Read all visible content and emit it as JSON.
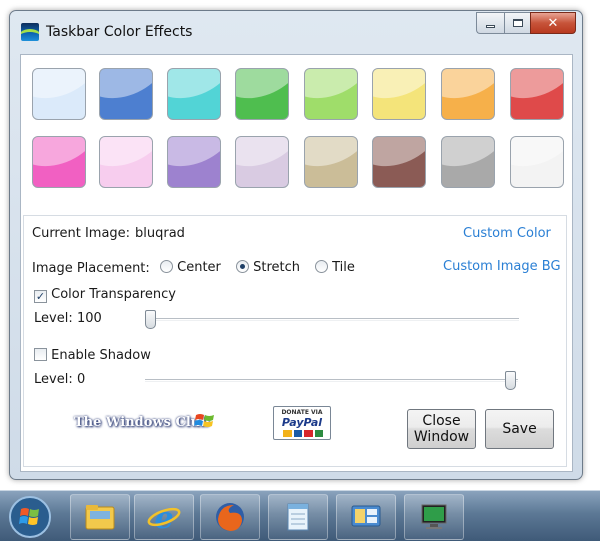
{
  "window": {
    "title": "Taskbar Color Effects",
    "close_glyph": "✕"
  },
  "swatches": [
    {
      "name": "swatch-white-blue",
      "color": "#dbeafa"
    },
    {
      "name": "swatch-blue",
      "color": "#4d7fd0"
    },
    {
      "name": "swatch-cyan",
      "color": "#52d4d6"
    },
    {
      "name": "swatch-green",
      "color": "#4fbe4f"
    },
    {
      "name": "swatch-lime",
      "color": "#9fdd6a"
    },
    {
      "name": "swatch-yellow",
      "color": "#f4e47a"
    },
    {
      "name": "swatch-orange",
      "color": "#f6b04a"
    },
    {
      "name": "swatch-red",
      "color": "#df4a4a"
    },
    {
      "name": "swatch-pink",
      "color": "#f160c2"
    },
    {
      "name": "swatch-light-pink",
      "color": "#f7cdee"
    },
    {
      "name": "swatch-purple",
      "color": "#9d82cf"
    },
    {
      "name": "swatch-lavender",
      "color": "#d9cbe2"
    },
    {
      "name": "swatch-tan",
      "color": "#cbbd98"
    },
    {
      "name": "swatch-brown",
      "color": "#8b5b55"
    },
    {
      "name": "swatch-gray",
      "color": "#a9a9a9"
    },
    {
      "name": "swatch-white",
      "color": "#f3f3f3"
    }
  ],
  "settings": {
    "current_image_label": "Current Image:",
    "current_image_value": "bluqrad",
    "custom_color_link": "Custom Color",
    "placement_label": "Image Placement:",
    "placement_options": [
      "Center",
      "Stretch",
      "Tile"
    ],
    "placement_selected": "Stretch",
    "custom_image_link": "Custom Image BG",
    "transparency_label": "Color Transparency",
    "transparency_checked": true,
    "transparency_level_label": "Level:",
    "transparency_level_value": "100",
    "shadow_label": "Enable Shadow",
    "shadow_checked": false,
    "shadow_level_label": "Level:",
    "shadow_level_value": "0"
  },
  "branding": {
    "twc_logo_text": "The Windows Club",
    "paypal_top": "DONATE VIA",
    "paypal_brand": "PayPal"
  },
  "buttons": {
    "close_window_line1": "Close",
    "close_window_line2": "Window",
    "save": "Save"
  },
  "taskbar": {
    "items": [
      "start-orb",
      "explorer",
      "internet-explorer",
      "firefox",
      "notepad",
      "remote-desktop",
      "computer"
    ]
  },
  "colors": {
    "link": "#2a7fd4",
    "taskbar": "#5c7895"
  }
}
